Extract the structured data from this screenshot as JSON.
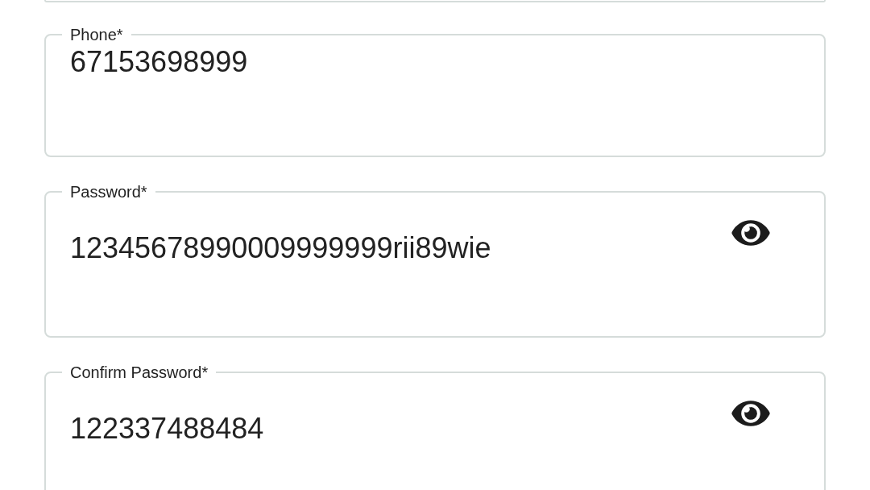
{
  "fields": [
    {
      "kind": "text",
      "label": "Phone*",
      "value": "67153698999"
    },
    {
      "kind": "password",
      "label": "Password*",
      "value": "12345678990009999999rii89wie",
      "revealed": true
    },
    {
      "kind": "password",
      "label": "Confirm Password*",
      "value": "122337488484",
      "revealed": true
    }
  ]
}
